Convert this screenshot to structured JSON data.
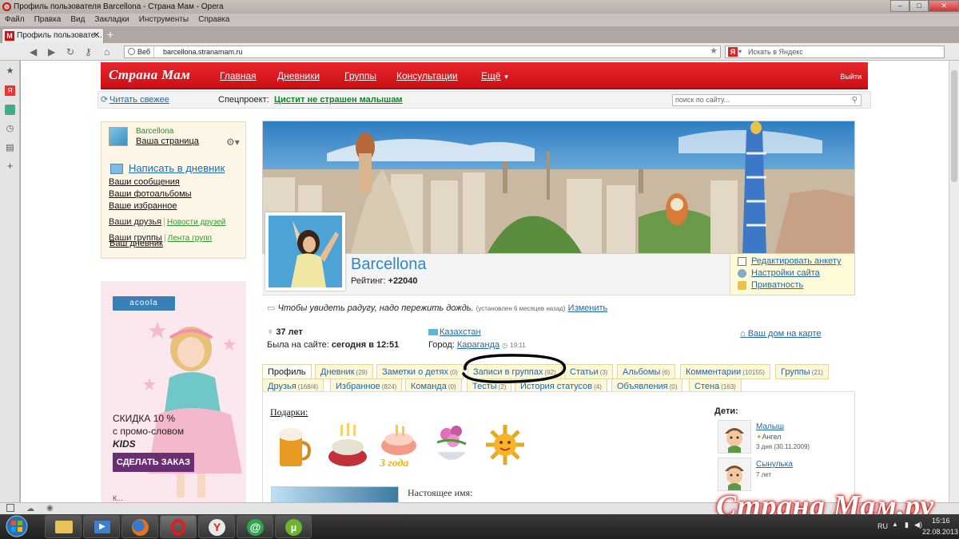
{
  "window": {
    "title": "Профиль пользователя Barcellona - Страна Мам - Opera",
    "menu": [
      "Файл",
      "Правка",
      "Вид",
      "Закладки",
      "Инструменты",
      "Справка"
    ]
  },
  "tab": {
    "title": "Профиль пользовате..."
  },
  "address": {
    "web_label": "Веб",
    "url": "barcellona.stranamam.ru",
    "search_placeholder": "Искать в Яндекс"
  },
  "site": {
    "logo": "Страна Мам",
    "nav": [
      "Главная",
      "Дневники",
      "Группы",
      "Консультации",
      "Ещё"
    ],
    "logout": "Выйти",
    "refresh": "Читать свежее",
    "special_label": "Спецпроект:",
    "special_link": "Цистит не страшен малышам",
    "search_placeholder": "поиск по сайту..."
  },
  "userbox": {
    "name": "Barcellona",
    "my_page": "Ваша страница",
    "write_diary": "Написать в дневник",
    "links": [
      "Ваш дневник",
      "Ваши сообщения",
      "Ваши фотоальбомы",
      "Ваше избранное"
    ],
    "friends": "Ваши друзья",
    "friends_news": "Новости друзей",
    "groups": "Ваши группы",
    "groups_feed": "Лента групп"
  },
  "ad": {
    "brand": "acoola",
    "line1": "СКИДКА 10 %",
    "line2": "с промо-словом",
    "line3": "KIDS",
    "button": "СДЕЛАТЬ ЗАКАЗ",
    "tail": "К..."
  },
  "profile": {
    "name": "Barcellona",
    "rating_label": "Рейтинг:",
    "rating_value": "+22040",
    "actions": [
      "Редактировать анкету",
      "Настройки сайта",
      "Приватность"
    ],
    "status": "Чтобы увидеть радугу, надо пережить дождь.",
    "status_meta": "(установлен 6 месяцев назад)",
    "status_change": "Изменить",
    "age": "37 лет",
    "last_seen_label": "Была на сайте:",
    "last_seen_value": "сегодня в 12:51",
    "country": "Казахстан",
    "city_label": "Город:",
    "city": "Караганда",
    "city_time": "19:11",
    "map_link": "Ваш дом на карте"
  },
  "tabs_row1": [
    {
      "label": "Профиль",
      "count": ""
    },
    {
      "label": "Дневник",
      "count": "(29)"
    },
    {
      "label": "Заметки о детях",
      "count": "(0)"
    },
    {
      "label": "Записи в группах",
      "count": "(92)"
    },
    {
      "label": "Статьи",
      "count": "(3)"
    },
    {
      "label": "Альбомы",
      "count": "(6)"
    },
    {
      "label": "Комментарии",
      "count": "(10155)"
    },
    {
      "label": "Группы",
      "count": "(21)"
    }
  ],
  "tabs_row2": [
    {
      "label": "Друзья",
      "count": "(168/4)"
    },
    {
      "label": "Избранное",
      "count": "(824)"
    },
    {
      "label": "Команда",
      "count": "(0)"
    },
    {
      "label": "Тесты",
      "count": "(2)"
    },
    {
      "label": "История статусов",
      "count": "(4)"
    },
    {
      "label": "Объявления",
      "count": "(0)"
    },
    {
      "label": "Стена",
      "count": "(163)"
    }
  ],
  "gifts": {
    "label": "Подарки:",
    "cake_text": "3 года"
  },
  "realname_label": "Настоящее имя:",
  "kids": {
    "label": "Дети:",
    "items": [
      {
        "name": "Малыш",
        "sub1": "Ангел",
        "sub2": "3 дня (30.11.2009)"
      },
      {
        "name": "Сынулька",
        "sub1": "7 лет",
        "sub2": ""
      }
    ]
  },
  "watermark": "Страна Мам.ру",
  "taskbar": {
    "lang": "RU",
    "time": "15:16",
    "date": "22.08.2013"
  }
}
